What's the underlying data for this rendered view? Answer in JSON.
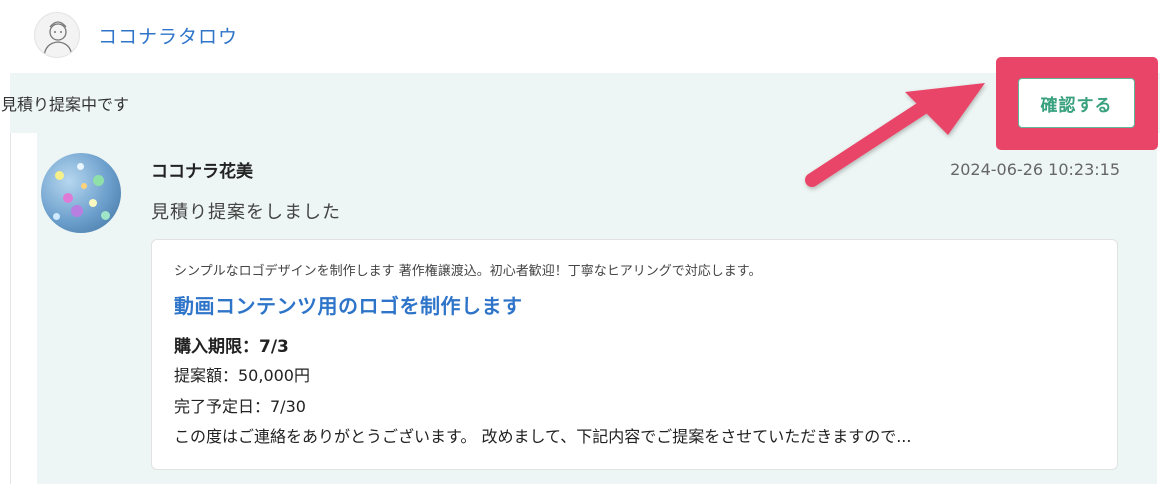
{
  "header_user": {
    "name": "ココナラタロウ",
    "avatar_icon": "user-avatar-icon"
  },
  "status": {
    "text": "見積り提案中です",
    "confirm_label": "確認する",
    "highlight_color": "#e94568"
  },
  "message": {
    "sender": "ココナラ花美",
    "timestamp": "2024-06-26 10:23:15",
    "text": "見積り提案をしました"
  },
  "proposal_card": {
    "service_subtitle": "シンプルなロゴデザインを制作します 著作権譲渡込。初心者歓迎！丁寧なヒアリングで対応します。",
    "title": "動画コンテンツ用のロゴを制作します",
    "deadline": "購入期限：7/3",
    "price": "提案額：50,000円",
    "completion_date": "完了予定日：7/30",
    "body": "この度はご連絡をありがとうございます。 改めまして、下記内容でご提案をさせていただきますので..."
  },
  "colors": {
    "link_blue": "#2e74c9",
    "status_bg": "#edf6f4",
    "confirm_green": "#3aa17f",
    "arrow_pink": "#e94568"
  }
}
